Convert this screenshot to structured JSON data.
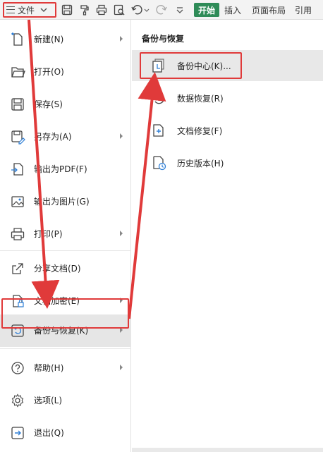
{
  "toolbar": {
    "file_label": "文件",
    "start_label": "开始",
    "tabs": [
      "插入",
      "页面布局",
      "引用"
    ]
  },
  "menu": {
    "items": [
      {
        "label": "新建(N)",
        "icon": "new-document-icon",
        "submenu": true
      },
      {
        "label": "打开(O)",
        "icon": "folder-open-icon",
        "submenu": false
      },
      {
        "label": "保存(S)",
        "icon": "save-icon",
        "submenu": false
      },
      {
        "label": "另存为(A)",
        "icon": "save-as-icon",
        "submenu": true
      },
      {
        "label": "输出为PDF(F)",
        "icon": "export-pdf-icon",
        "submenu": false
      },
      {
        "label": "输出为图片(G)",
        "icon": "export-image-icon",
        "submenu": false
      },
      {
        "label": "打印(P)",
        "icon": "printer-icon",
        "submenu": true
      },
      {
        "label": "分享文档(D)",
        "icon": "share-icon",
        "submenu": false
      },
      {
        "label": "文档加密(E)",
        "icon": "encrypt-icon",
        "submenu": true
      },
      {
        "label": "备份与恢复(K)",
        "icon": "backup-restore-icon",
        "submenu": true,
        "active": true
      },
      {
        "label": "帮助(H)",
        "icon": "help-icon",
        "submenu": true
      },
      {
        "label": "选项(L)",
        "icon": "gear-icon",
        "submenu": false
      },
      {
        "label": "退出(Q)",
        "icon": "exit-icon",
        "submenu": false
      }
    ]
  },
  "submenu": {
    "title": "备份与恢复",
    "items": [
      {
        "label": "备份中心(K)...",
        "icon": "backup-center-icon",
        "highlighted": true
      },
      {
        "label": "数据恢复(R)",
        "icon": "data-recovery-icon"
      },
      {
        "label": "文档修复(F)",
        "icon": "document-repair-icon"
      },
      {
        "label": "历史版本(H)",
        "icon": "history-version-icon"
      }
    ]
  },
  "colors": {
    "accent_green": "#2e8b57",
    "highlight_red": "#e03a3a",
    "active_bg": "#e6e6e6"
  }
}
